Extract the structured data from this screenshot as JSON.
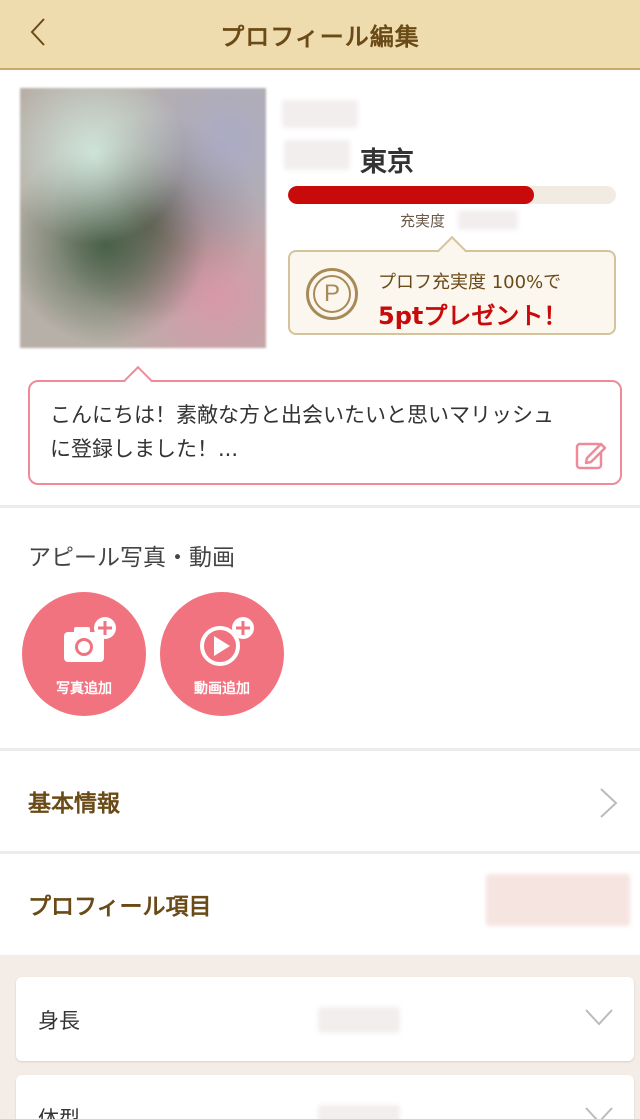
{
  "header": {
    "title": "プロフィール編集"
  },
  "profile": {
    "prefecture": "東京",
    "completeness_label": "充実度",
    "completeness_percent": 75,
    "bonus_line1": "プロフ充実度 100%で",
    "bonus_line2": "5ptプレゼント！",
    "coin_letter": "P"
  },
  "intro": {
    "text": "こんにちは！素敵な方と出会いたいと思いマリッシュに登録しました！..."
  },
  "appeal": {
    "title": "アピール写真・動画",
    "photo_add_label": "写真追加",
    "video_add_label": "動画追加"
  },
  "rows": {
    "basic_info": "基本情報",
    "profile_items": "プロフィール項目"
  },
  "items": [
    {
      "label": "身長"
    },
    {
      "label": "体型"
    }
  ],
  "colors": {
    "header_bg": "#efdcae",
    "accent_red": "#c80a0a",
    "pink": "#f1737f",
    "gold_text": "#6a4b17"
  }
}
